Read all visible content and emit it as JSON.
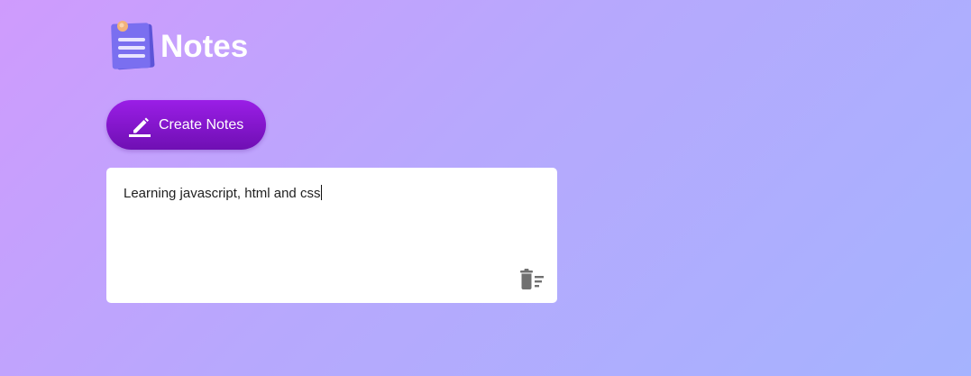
{
  "app": {
    "title": "Notes",
    "logo_icon": "notepad-icon"
  },
  "toolbar": {
    "create_label": "Create Notes",
    "create_icon": "pencil-icon"
  },
  "notes": [
    {
      "text": "Learning javascript, html and css",
      "delete_icon": "delete-sweep-icon"
    }
  ],
  "colors": {
    "accent": "#8a16d6",
    "background_start": "#cf9bfd",
    "background_end": "#a5b3fe",
    "card": "#ffffff",
    "icon_gray": "#707070"
  }
}
